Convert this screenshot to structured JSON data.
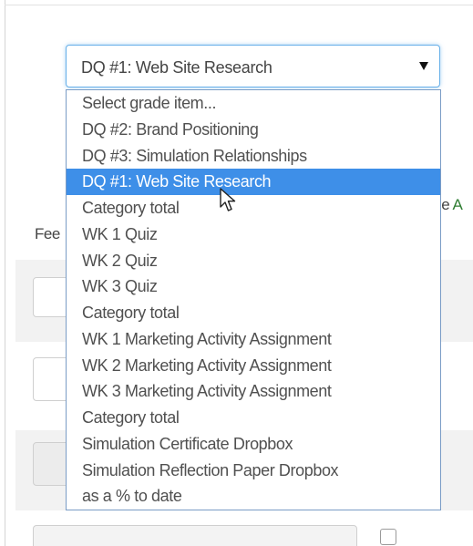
{
  "background": {
    "left_label_fragment": "Fee",
    "right_label_fragment": {
      "prefix": "le ",
      "accent": "A"
    }
  },
  "grade_select": {
    "selected_value": "DQ #1: Web Site Research",
    "accent_color": "#3e8fe8",
    "options": [
      "Select grade item...",
      "DQ #2: Brand Positioning",
      "DQ #3: Simulation Relationships",
      "DQ #1: Web Site Research",
      "Category total",
      "WK 1 Quiz",
      "WK 2 Quiz",
      "WK 3 Quiz",
      "Category total",
      "WK 1 Marketing Activity Assignment",
      "WK 2 Marketing Activity Assignment",
      "WK 3 Marketing Activity Assignment",
      "Category total",
      "Simulation Certificate Dropbox",
      "Simulation Reflection Paper Dropbox",
      "as a % to date"
    ],
    "highlighted_index": 3
  },
  "icons": {
    "dropdown_arrow": "chevron-down-icon",
    "pointer": "mouse-pointer-icon"
  }
}
